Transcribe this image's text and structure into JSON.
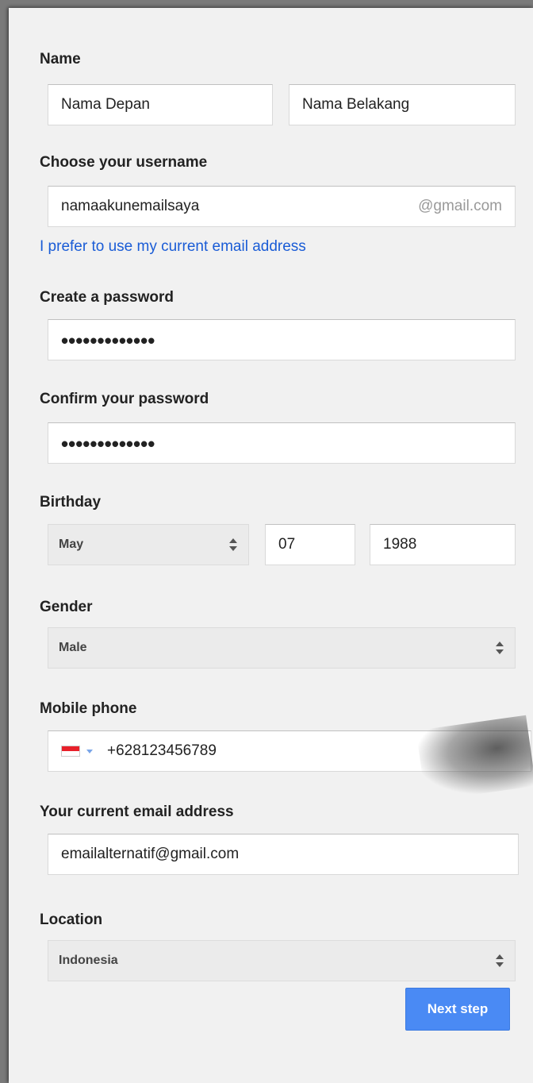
{
  "form": {
    "name": {
      "label": "Name",
      "first_value": "Nama Depan",
      "last_value": "Nama Belakang"
    },
    "username": {
      "label": "Choose your username",
      "value": "namaakunemailsaya",
      "suffix": "@gmail.com",
      "alt_link": "I prefer to use my current email address"
    },
    "password": {
      "label": "Create a password",
      "value": "•••••••••••••"
    },
    "confirm_password": {
      "label": "Confirm your password",
      "value": "•••••••••••••"
    },
    "birthday": {
      "label": "Birthday",
      "month": "May",
      "day": "07",
      "year": "1988"
    },
    "gender": {
      "label": "Gender",
      "value": "Male"
    },
    "mobile": {
      "label": "Mobile phone",
      "value": "+628123456789",
      "flag_icon": "indonesia-flag-icon"
    },
    "current_email": {
      "label": "Your current email address",
      "value": "emailalternatif@gmail.com"
    },
    "location": {
      "label": "Location",
      "value": "Indonesia"
    },
    "next_button": "Next step"
  },
  "colors": {
    "panel_bg": "#f1f1f1",
    "link": "#1a5cd6",
    "button_bg": "#4a8af4"
  }
}
